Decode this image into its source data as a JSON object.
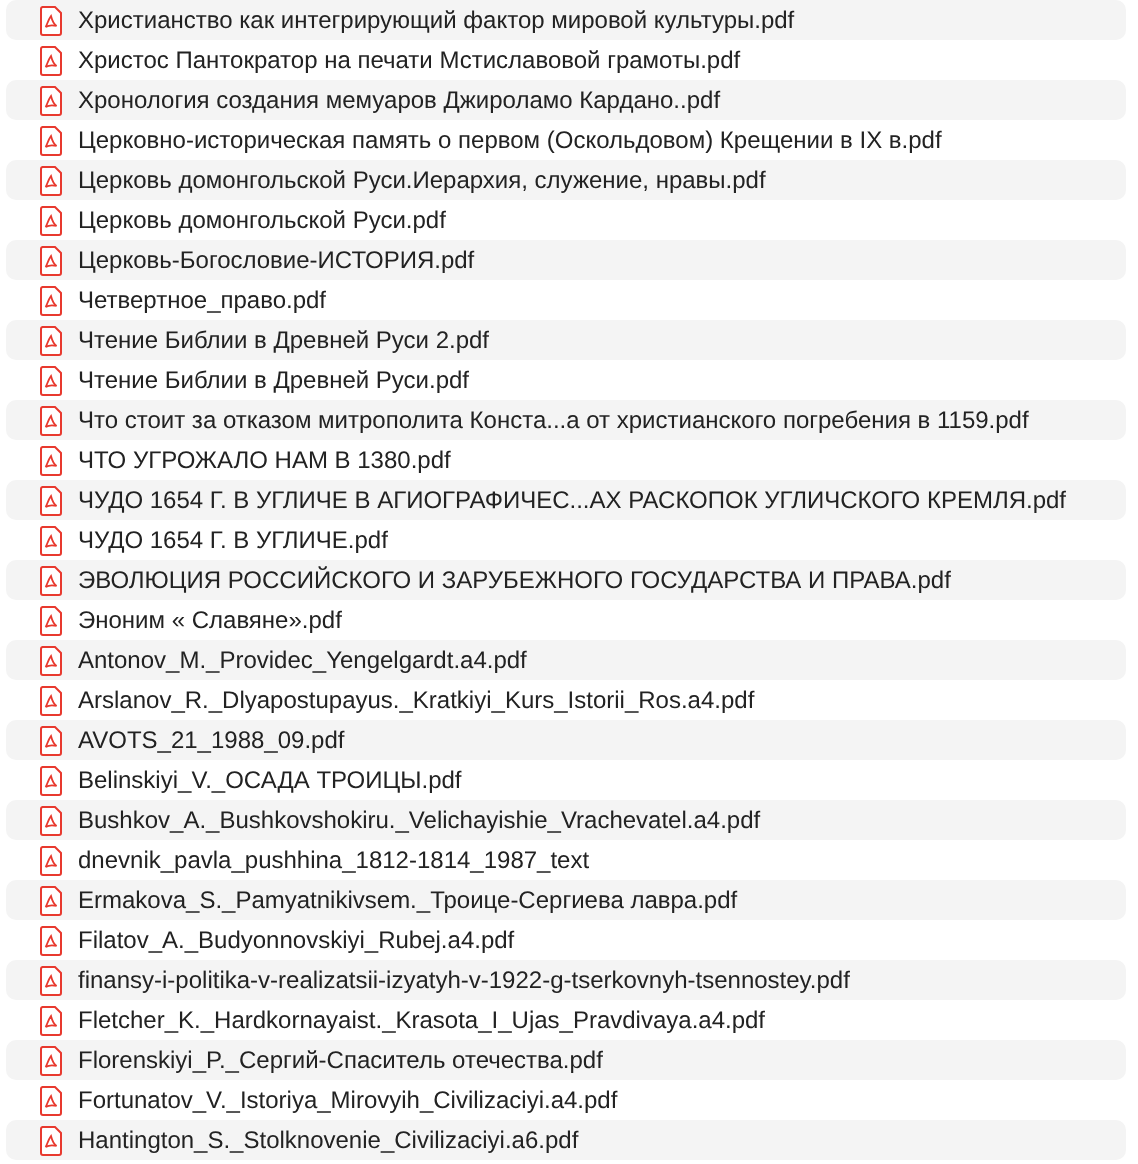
{
  "files": [
    {
      "name": "Христианство как интегрирующий фактор мировой культуры.pdf"
    },
    {
      "name": "Христос Пантократор на печати Мстиславовой грамоты.pdf"
    },
    {
      "name": "Хронология создания мемуаров Джироламо Кардано..pdf"
    },
    {
      "name": "Церковно-историческая память о первом (Оскольдовом) Крещении в IX в.pdf"
    },
    {
      "name": "Церковь домонгольской Руси.Иерархия, служение, нравы.pdf"
    },
    {
      "name": "Церковь домонгольской Руси.pdf"
    },
    {
      "name": "Церковь-Богословие-ИСТОРИЯ.pdf"
    },
    {
      "name": "Четвертное_право.pdf"
    },
    {
      "name": "Чтение Библии в Древней Руси 2.pdf"
    },
    {
      "name": "Чтение Библии в Древней Руси.pdf"
    },
    {
      "name": "Что стоит за отказом митрополита Конста...а от христианского погребения в 1159.pdf"
    },
    {
      "name": "ЧТО УГРОЖАЛО НАМ В 1380.pdf"
    },
    {
      "name": "ЧУДО 1654 Г. В УГЛИЧЕ В АГИОГРАФИЧЕС...АХ РАСКОПОК УГЛИЧСКОГО КРЕМЛЯ.pdf"
    },
    {
      "name": "ЧУДО 1654 Г. В УГЛИЧЕ.pdf"
    },
    {
      "name": "ЭВОЛЮЦИЯ РОССИЙСКОГО И ЗАРУБЕЖНОГО ГОСУДАРСТВА И ПРАВА.pdf"
    },
    {
      "name": "Эноним « Славяне».pdf"
    },
    {
      "name": "Antonov_M._Providec_Yengelgardt.a4.pdf"
    },
    {
      "name": "Arslanov_R._Dlyapostupayus._Kratkiyi_Kurs_Istorii_Ros.a4.pdf"
    },
    {
      "name": "AVOTS_21_1988_09.pdf"
    },
    {
      "name": "Belinskiyi_V._ОСАДА ТРОИЦЫ.pdf"
    },
    {
      "name": "Bushkov_A._Bushkovshokiru._Velichayishie_Vrachevatel.a4.pdf"
    },
    {
      "name": "dnevnik_pavla_pushhina_1812-1814_1987_text"
    },
    {
      "name": "Ermakova_S._Pamyatnikivsem._Троице-Сергиева лавра.pdf"
    },
    {
      "name": "Filatov_A._Budyonnovskiyi_Rubej.a4.pdf"
    },
    {
      "name": "finansy-i-politika-v-realizatsii-izyatyh-v-1922-g-tserkovnyh-tsennostey.pdf"
    },
    {
      "name": "Fletcher_K._Hardkornayaist._Krasota_I_Ujas_Pravdivaya.a4.pdf"
    },
    {
      "name": "Florenskiyi_P._Сергий-Спаситель отечества.pdf"
    },
    {
      "name": "Fortunatov_V._Istoriya_Mirovyih_Civilizaciyi.a4.pdf"
    },
    {
      "name": "Hantington_S._Stolknovenie_Civilizaciyi.a6.pdf"
    }
  ]
}
